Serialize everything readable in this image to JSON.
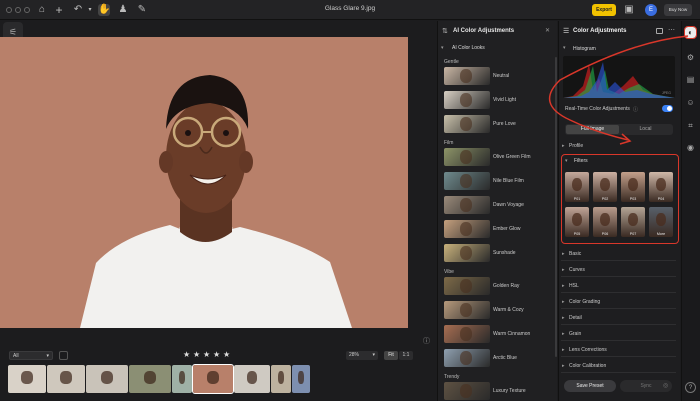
{
  "window": {
    "title": "Glass Glare 9.jpg"
  },
  "titlebar": {
    "export_label": "Export",
    "avatar_letter": "E",
    "buy_label": "Buy Now"
  },
  "filmstrip": {
    "filter_value": "All",
    "zoom_value": "28%",
    "fit_label": "Fit",
    "one_label": "1:1",
    "rating_stars": 5,
    "star_glyph": "★",
    "thumbs": [
      {
        "color": "#d9d2c8"
      },
      {
        "color": "#cfc8bd"
      },
      {
        "color": "#c9c3b9"
      },
      {
        "color": "#8b8f74"
      },
      {
        "color": "#9fb1a6"
      },
      {
        "color": "#b8806a"
      },
      {
        "color": "#cfcac2"
      },
      {
        "color": "#bdb29f"
      },
      {
        "color": "#7d8fb0"
      }
    ]
  },
  "ai_panel": {
    "title": "AI Color Adjustments",
    "close_glyph": "✕",
    "looks_header": "AI Color Looks",
    "groups": [
      {
        "name": "Gentle",
        "items": [
          {
            "name": "Neutral",
            "color": "#c9b6a4"
          },
          {
            "name": "Vivid Light",
            "color": "#d8d0c4"
          },
          {
            "name": "Pure Love",
            "color": "#c8c0aa"
          }
        ]
      },
      {
        "name": "Film",
        "items": [
          {
            "name": "Olive Green Film",
            "color": "#8d9468"
          },
          {
            "name": "Nile Blue Film",
            "color": "#6f8b8e"
          },
          {
            "name": "Dawn Voyage",
            "color": "#9a8a7a"
          },
          {
            "name": "Ember Glow",
            "color": "#c5a07e"
          },
          {
            "name": "Sunshade",
            "color": "#c9b27c"
          }
        ]
      },
      {
        "name": "Vibe",
        "items": [
          {
            "name": "Golden Ray",
            "color": "#7d6a48"
          },
          {
            "name": "Warm & Cozy",
            "color": "#b79a7c"
          },
          {
            "name": "Warm Cinnamon",
            "color": "#a86e52"
          },
          {
            "name": "Arctic Blue",
            "color": "#8fa0b0"
          }
        ]
      },
      {
        "name": "Trendy",
        "items": [
          {
            "name": "Luxury Texture",
            "color": "#5e5243"
          }
        ]
      }
    ]
  },
  "color_panel": {
    "title": "Color Adjustments",
    "histogram_label": "Histogram",
    "histogram_badge": "JPEG",
    "realtime_label": "Real-Time Color Adjustments",
    "realtime_on": true,
    "seg_full": "Full Image",
    "seg_local": "Local",
    "profile_label": "Profile",
    "filters_label": "Filters",
    "filters": [
      {
        "label": "P01",
        "color": "#c4a89b"
      },
      {
        "label": "P02",
        "color": "#cdb1a3"
      },
      {
        "label": "P03",
        "color": "#c3a08b"
      },
      {
        "label": "P04",
        "color": "#d0b8a8"
      },
      {
        "label": "P05",
        "color": "#c1a597"
      },
      {
        "label": "P06",
        "color": "#b99c8d"
      },
      {
        "label": "P07",
        "color": "#b4a596"
      },
      {
        "label": "More",
        "color": "#58606a"
      }
    ],
    "sections": [
      "Basic",
      "Curves",
      "HSL",
      "Color Grading",
      "Detail",
      "Grain",
      "Lens Corrections",
      "Color Calibration"
    ],
    "save_label": "Save Preset",
    "sync_label": "Sync",
    "help_glyph": "?",
    "accent_red": "#d9372a",
    "toggle_blue": "#3b82f6"
  }
}
